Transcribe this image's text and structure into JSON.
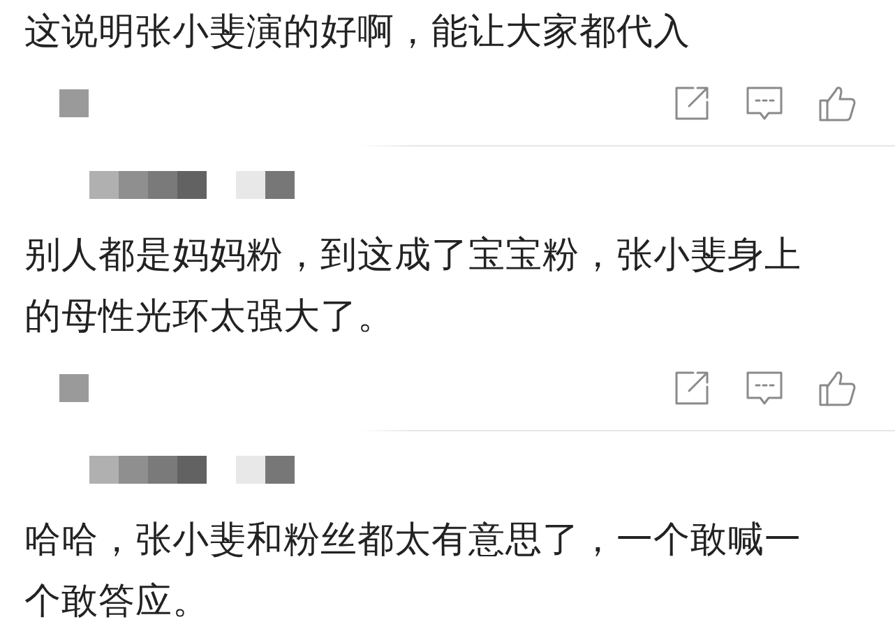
{
  "feed": [
    {
      "kind": "comment_text",
      "text": "这说明张小斐演的好啊，能让大家都代入"
    },
    {
      "kind": "action_bar"
    },
    {
      "kind": "divider"
    },
    {
      "kind": "author_bar"
    },
    {
      "kind": "comment_text",
      "text": "别人都是妈妈粉，到这成了宝宝粉，张小斐身上的母性光环太强大了。"
    },
    {
      "kind": "action_bar"
    },
    {
      "kind": "divider"
    },
    {
      "kind": "author_bar"
    },
    {
      "kind": "comment_text",
      "text": "哈哈，张小斐和粉丝都太有意思了，一个敢喊一个敢答应。"
    }
  ]
}
